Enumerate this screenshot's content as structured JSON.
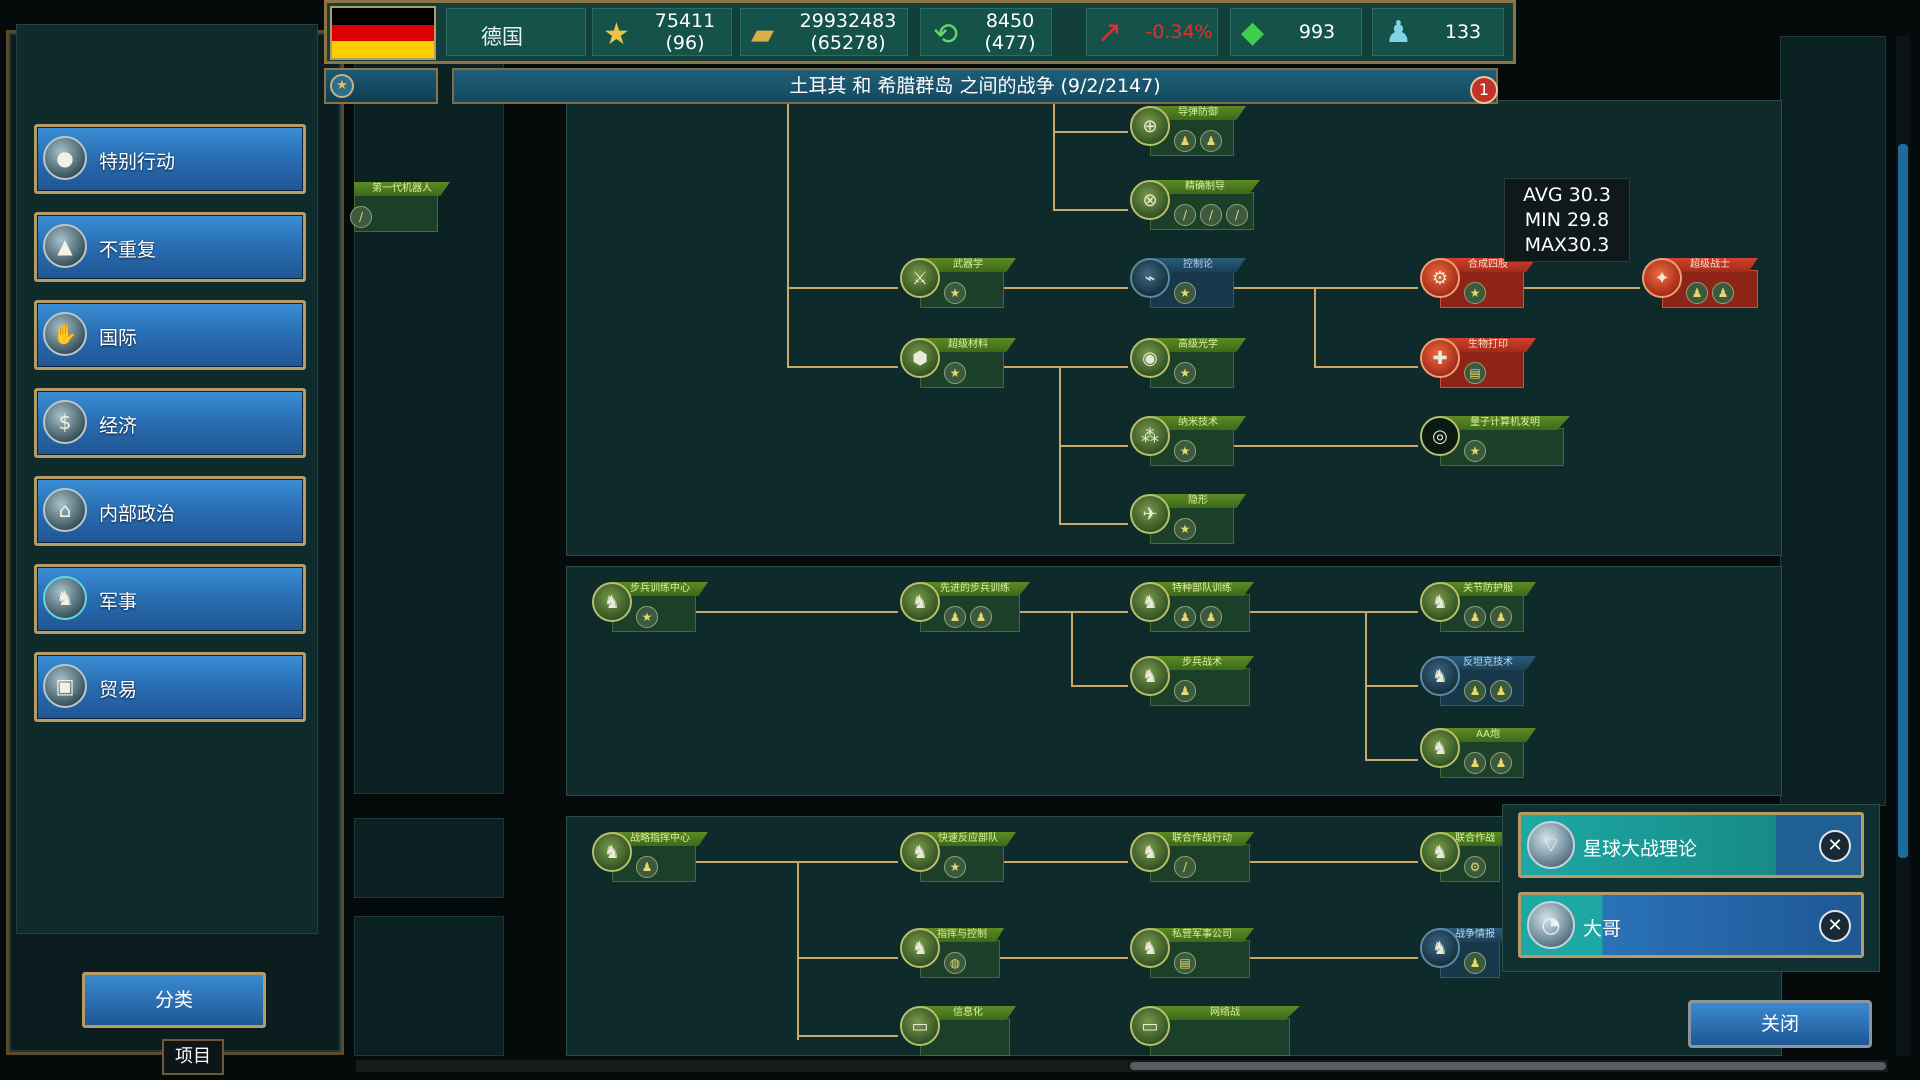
{
  "country": {
    "name": "德国",
    "flag_colors": [
      "#000000",
      "#dd0000",
      "#ffce00"
    ]
  },
  "resources": [
    {
      "icon": "star-icon",
      "value": "75411",
      "sub": "(96)"
    },
    {
      "icon": "gold-bars-icon",
      "value": "29932483",
      "sub": "(65278)"
    },
    {
      "icon": "cycle-icon",
      "value": "8450",
      "sub": "(477)"
    },
    {
      "icon": "growth-chart-icon",
      "value": "-0.34%",
      "sub": ""
    },
    {
      "icon": "crystal-icon",
      "value": "993",
      "sub": ""
    },
    {
      "icon": "soldier-icon",
      "value": "133",
      "sub": ""
    }
  ],
  "war_banner": {
    "text": "土耳其 和 希腊群岛 之间的战争 (9/2/2147)",
    "count": "1"
  },
  "sidebar": {
    "categories": [
      {
        "label": "特别行动",
        "icon": "bomb-icon"
      },
      {
        "label": "不重复",
        "icon": "tower-icon"
      },
      {
        "label": "国际",
        "icon": "handshake-icon"
      },
      {
        "label": "经济",
        "icon": "economy-icon"
      },
      {
        "label": "内部政治",
        "icon": "capitol-icon"
      },
      {
        "label": "军事",
        "icon": "soldier-icon"
      },
      {
        "label": "贸易",
        "icon": "trade-icon"
      }
    ],
    "filter_label": "分类",
    "items_tab_label": "项目"
  },
  "fps": {
    "avg": "AVG 30.3",
    "min": "MIN 29.8",
    "max": "MAX30.3"
  },
  "tech_nodes": {
    "n1": "导弹防御",
    "n2": "精确制导",
    "n3": "武器学",
    "n4": "控制论",
    "n5": "合成四肢",
    "n6": "超级战士",
    "n7": "超级材料",
    "n8": "高级光学",
    "n9": "生物打印",
    "n10": "纳米技术",
    "n11": "量子计算机发明",
    "n12": "隐形",
    "n13": "第一代机器人",
    "m1": "步兵训练中心",
    "m2": "先进的步兵训练",
    "m3": "特种部队训练",
    "m4": "关节防护服",
    "m5": "步兵战术",
    "m6": "反坦克技术",
    "m7": "AA炮",
    "s1": "战略指挥中心",
    "s2": "快速反应部队",
    "s3": "联合作战行动",
    "s4": "联合作战",
    "s5": "指挥与控制",
    "s6": "私营军事公司",
    "s7": "战争情报",
    "s8": "信息化",
    "s9": "网络战"
  },
  "popup": {
    "items": [
      {
        "label": "星球大战理论",
        "icon": "satellite-dish-icon"
      },
      {
        "label": "大哥",
        "icon": "security-camera-icon"
      }
    ]
  },
  "close_label": "关闭",
  "colors": {
    "negative": "#e0322a",
    "button_blue": "#2a6fb5",
    "gold_border": "#b89a63",
    "panel_bg": "#0e2a2b",
    "tech_green": "#3b6a1a",
    "tech_red": "#a32a1c",
    "line_gold": "#c9a86a"
  }
}
